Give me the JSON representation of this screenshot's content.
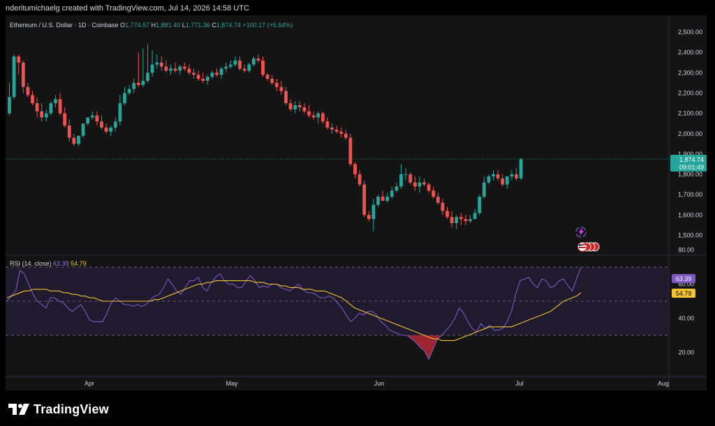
{
  "attribution": "nderitumichaelg created with TradingView.com, Jul 14, 2026 14:58 UTC",
  "legend": {
    "symbol": "Ethereum / U.S. Dollar · 1D · Coinbase",
    "open_label": "O",
    "open": "1,774.57",
    "high_label": "H",
    "high": "1,881.40",
    "low_label": "L",
    "low": "1,771.36",
    "close_label": "C",
    "close": "1,874.74",
    "change": "+100.17 (+5.64%)"
  },
  "rsi_legend": {
    "label": "RSI (14, close)",
    "rsi_value": "63.39",
    "ma_value": "54.79"
  },
  "price_badge": {
    "price": "1,874.74",
    "countdown": "09:01:49"
  },
  "rsi_badges": {
    "rsi": "63.39",
    "ma": "54.79"
  },
  "logo": {
    "text": "TradingView"
  },
  "colors": {
    "up": "#26a69a",
    "down": "#ef5350",
    "rsi": "#7e57c2",
    "ma": "#f5c431"
  },
  "chart_data": [
    {
      "type": "candlestick",
      "title": "Ethereum / U.S. Dollar · 1D · Coinbase",
      "x_tick_labels": [
        "Apr",
        "May",
        "Jun",
        "Jul",
        "Aug"
      ],
      "y_tick_labels": [
        "2,500.00",
        "2,400.00",
        "2,300.00",
        "2,200.00",
        "2,100.00",
        "2,000.00",
        "1,900.00",
        "1,800.00",
        "1,700.00",
        "1,600.00",
        "1,500.00"
      ],
      "ylim": [
        1460,
        2540
      ],
      "grid": false,
      "note": "daily OHLC estimated from the chart, starting Mar 17, 2026",
      "open": [
        2100,
        2180,
        2380,
        2350,
        2230,
        2190,
        2150,
        2110,
        2080,
        2100,
        2150,
        2170,
        2100,
        2040,
        1980,
        1950,
        1990,
        2050,
        2080,
        2090,
        2060,
        2030,
        2010,
        2030,
        2060,
        2150,
        2200,
        2220,
        2250,
        2240,
        2260,
        2300,
        2340,
        2350,
        2330,
        2310,
        2320,
        2310,
        2330,
        2320,
        2300,
        2290,
        2270,
        2260,
        2280,
        2300,
        2290,
        2320,
        2330,
        2340,
        2360,
        2320,
        2310,
        2340,
        2370,
        2360,
        2290,
        2270,
        2250,
        2230,
        2210,
        2150,
        2120,
        2140,
        2130,
        2110,
        2090,
        2080,
        2100,
        2060,
        2030,
        2020,
        2010,
        2000,
        1980,
        1850,
        1800,
        1750,
        1600,
        1580,
        1650,
        1690,
        1670,
        1690,
        1720,
        1740,
        1800,
        1800,
        1760,
        1740,
        1760,
        1750,
        1720,
        1690,
        1660,
        1620,
        1590,
        1560,
        1590,
        1580,
        1570,
        1580,
        1610,
        1690,
        1760,
        1790,
        1800,
        1780,
        1750,
        1790,
        1800,
        1780
      ],
      "high": [
        2250,
        2390,
        2390,
        2360,
        2250,
        2210,
        2180,
        2150,
        2120,
        2160,
        2190,
        2200,
        2130,
        2070,
        2000,
        1990,
        2030,
        2080,
        2110,
        2110,
        2090,
        2050,
        2040,
        2080,
        2190,
        2230,
        2240,
        2270,
        2400,
        2420,
        2440,
        2410,
        2390,
        2380,
        2360,
        2340,
        2350,
        2340,
        2350,
        2340,
        2320,
        2310,
        2300,
        2290,
        2310,
        2320,
        2330,
        2350,
        2360,
        2380,
        2380,
        2340,
        2350,
        2380,
        2390,
        2380,
        2300,
        2290,
        2270,
        2260,
        2230,
        2170,
        2160,
        2160,
        2150,
        2140,
        2110,
        2110,
        2110,
        2080,
        2050,
        2040,
        2030,
        2020,
        2000,
        1860,
        1820,
        1770,
        1620,
        1680,
        1700,
        1720,
        1710,
        1740,
        1760,
        1850,
        1830,
        1810,
        1790,
        1790,
        1780,
        1760,
        1740,
        1710,
        1680,
        1640,
        1620,
        1600,
        1610,
        1600,
        1600,
        1630,
        1700,
        1790,
        1800,
        1820,
        1820,
        1800,
        1790,
        1820,
        1830,
        1881
      ],
      "low": [
        2090,
        2170,
        2290,
        2200,
        2180,
        2140,
        2080,
        2060,
        2060,
        2090,
        2130,
        2090,
        2030,
        1960,
        1940,
        1940,
        1980,
        2040,
        2070,
        2040,
        2020,
        2000,
        1990,
        2010,
        2040,
        2140,
        2190,
        2200,
        2230,
        2230,
        2250,
        2280,
        2320,
        2310,
        2300,
        2290,
        2300,
        2290,
        2310,
        2290,
        2270,
        2260,
        2250,
        2240,
        2270,
        2280,
        2270,
        2300,
        2320,
        2330,
        2310,
        2300,
        2300,
        2330,
        2350,
        2280,
        2260,
        2240,
        2210,
        2190,
        2140,
        2110,
        2100,
        2110,
        2100,
        2080,
        2070,
        2050,
        2050,
        2020,
        2000,
        2000,
        1980,
        1970,
        1840,
        1780,
        1740,
        1590,
        1570,
        1520,
        1640,
        1670,
        1660,
        1680,
        1710,
        1730,
        1770,
        1750,
        1720,
        1710,
        1740,
        1710,
        1680,
        1650,
        1600,
        1580,
        1540,
        1530,
        1550,
        1550,
        1560,
        1580,
        1600,
        1680,
        1750,
        1770,
        1770,
        1740,
        1730,
        1770,
        1770,
        1771
      ],
      "close": [
        2180,
        2380,
        2350,
        2230,
        2190,
        2150,
        2110,
        2080,
        2100,
        2150,
        2170,
        2100,
        2040,
        1980,
        1950,
        1990,
        2050,
        2080,
        2090,
        2060,
        2030,
        2010,
        2030,
        2060,
        2150,
        2200,
        2220,
        2250,
        2240,
        2260,
        2300,
        2340,
        2350,
        2330,
        2310,
        2320,
        2310,
        2330,
        2320,
        2300,
        2290,
        2270,
        2260,
        2280,
        2300,
        2290,
        2320,
        2330,
        2340,
        2360,
        2320,
        2310,
        2340,
        2370,
        2360,
        2290,
        2270,
        2250,
        2230,
        2210,
        2150,
        2120,
        2140,
        2130,
        2110,
        2090,
        2080,
        2100,
        2060,
        2030,
        2020,
        2010,
        2000,
        1980,
        1850,
        1800,
        1750,
        1600,
        1580,
        1650,
        1690,
        1670,
        1690,
        1720,
        1740,
        1800,
        1800,
        1760,
        1740,
        1760,
        1750,
        1720,
        1690,
        1660,
        1620,
        1590,
        1560,
        1590,
        1580,
        1570,
        1580,
        1610,
        1690,
        1760,
        1790,
        1800,
        1780,
        1750,
        1790,
        1800,
        1780,
        1875
      ]
    },
    {
      "type": "line",
      "title": "RSI (14, close)",
      "y_tick_labels": [
        "80.00",
        "60.00",
        "40.00",
        "20.00"
      ],
      "ylim": [
        10,
        90
      ],
      "reference_lines": [
        70,
        50,
        30
      ],
      "series": [
        {
          "name": "RSI",
          "values": [
            50,
            53,
            56,
            68,
            66,
            60,
            54,
            50,
            48,
            46,
            52,
            52,
            50,
            49,
            46,
            44,
            46,
            48,
            44,
            39,
            38,
            38,
            38,
            43,
            49,
            52,
            50,
            48,
            48,
            47,
            48,
            47,
            48,
            51,
            53,
            54,
            58,
            63,
            60,
            56,
            54,
            58,
            62,
            62,
            64,
            58,
            56,
            61,
            64,
            66,
            62,
            60,
            60,
            58,
            58,
            62,
            65,
            62,
            58,
            59,
            58,
            60,
            60,
            58,
            57,
            56,
            58,
            60,
            57,
            55,
            55,
            54,
            52,
            52,
            53,
            52,
            49,
            46,
            42,
            38,
            40,
            43,
            42,
            44,
            44,
            42,
            38,
            36,
            33,
            32,
            31,
            30,
            30,
            28,
            26,
            23,
            21,
            16,
            22,
            28,
            30,
            33,
            36,
            40,
            46,
            43,
            38,
            34,
            32,
            37,
            34,
            36,
            33,
            33,
            34,
            38,
            44,
            54,
            62,
            63,
            64,
            60,
            58,
            63,
            62,
            58,
            59,
            62,
            63,
            59,
            56,
            63,
            70
          ]
        },
        {
          "name": "RSI-based MA",
          "values": [
            52,
            53,
            54,
            55,
            56,
            56,
            57,
            57,
            57,
            57,
            56,
            56,
            56,
            55,
            55,
            54,
            54,
            53,
            53,
            52,
            52,
            51,
            50,
            50,
            50,
            50,
            50,
            50,
            50,
            50,
            50,
            50,
            50,
            50,
            51,
            51,
            52,
            53,
            54,
            55,
            56,
            57,
            58,
            59,
            60,
            60,
            61,
            61,
            62,
            62,
            62,
            62,
            62,
            62,
            62,
            62,
            62,
            61,
            61,
            61,
            60,
            60,
            60,
            59,
            59,
            58,
            58,
            58,
            57,
            57,
            57,
            56,
            56,
            56,
            55,
            54,
            53,
            52,
            50,
            48,
            46,
            45,
            44,
            43,
            42,
            41,
            40,
            39,
            38,
            37,
            36,
            35,
            34,
            33,
            32,
            31,
            30,
            29,
            28,
            28,
            27,
            27,
            27,
            27,
            28,
            29,
            30,
            31,
            32,
            33,
            34,
            35,
            35,
            35,
            35,
            35,
            35,
            36,
            37,
            38,
            39,
            40,
            41,
            42,
            43,
            44,
            46,
            48,
            50,
            51,
            52,
            53,
            55
          ]
        }
      ]
    }
  ]
}
